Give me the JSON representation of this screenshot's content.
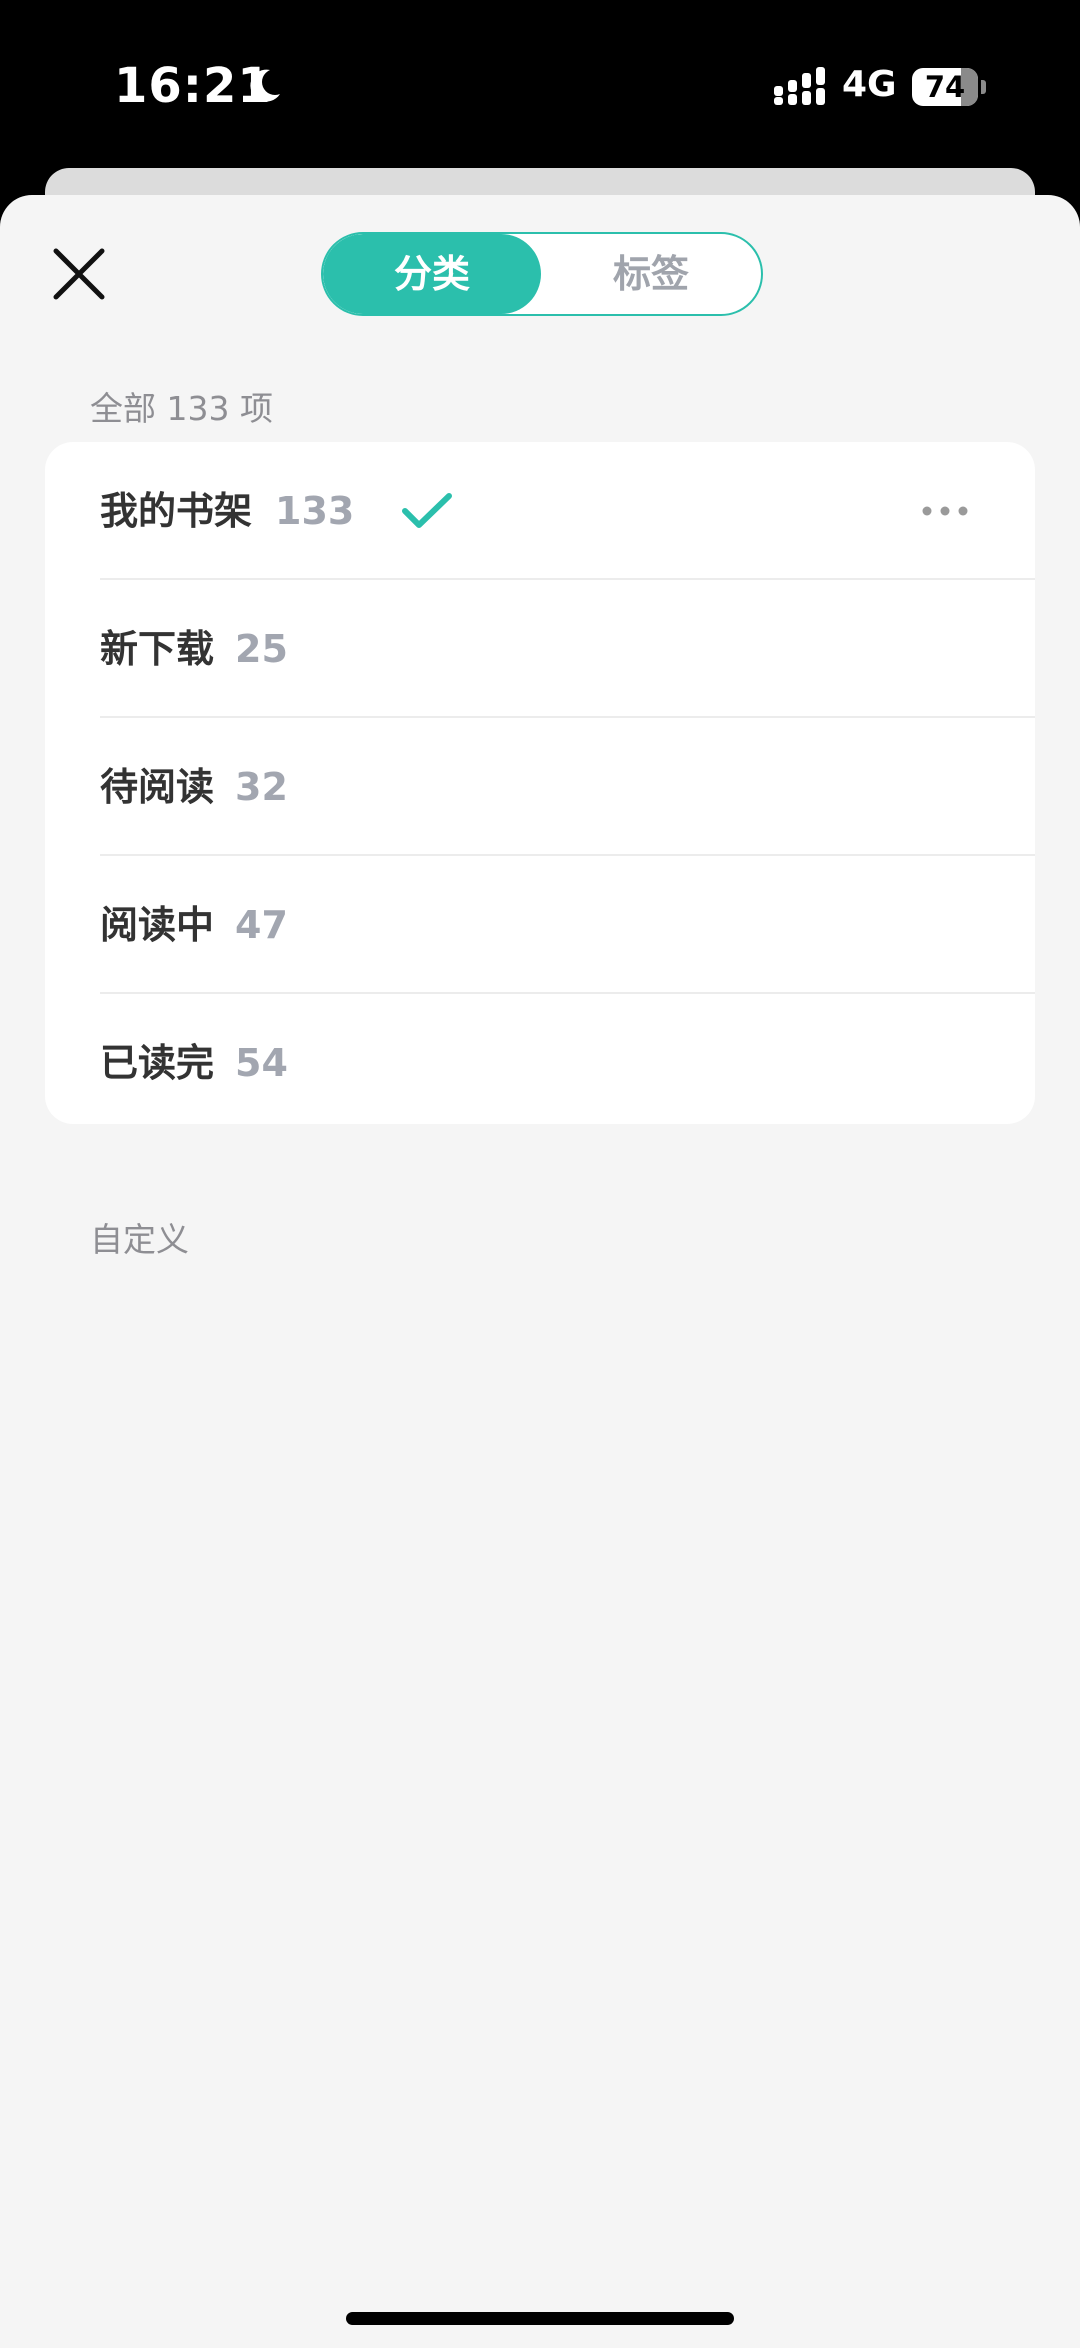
{
  "status_bar": {
    "time": "16:21",
    "network": "4G",
    "battery": "74"
  },
  "header": {
    "tabs": [
      {
        "label": "分类",
        "active": true
      },
      {
        "label": "标签",
        "active": false
      }
    ]
  },
  "sections": {
    "all_label": "全部 133 项",
    "custom_label": "自定义"
  },
  "shelves": [
    {
      "name": "我的书架",
      "count": "133",
      "selected": true
    },
    {
      "name": "新下载",
      "count": "25",
      "selected": false
    },
    {
      "name": "待阅读",
      "count": "32",
      "selected": false
    },
    {
      "name": "阅读中",
      "count": "47",
      "selected": false
    },
    {
      "name": "已读完",
      "count": "54",
      "selected": false
    }
  ],
  "colors": {
    "accent": "#2bbfac",
    "background": "#f5f5f5",
    "card": "#ffffff",
    "text_primary": "#333333",
    "text_count": "#a2a6b0",
    "text_label": "#8e8e93"
  },
  "icons": {
    "close": "close-icon",
    "check": "check-icon",
    "more": "more-icon",
    "moon": "moon-icon",
    "signal": "signal-icon",
    "battery": "battery-icon"
  }
}
